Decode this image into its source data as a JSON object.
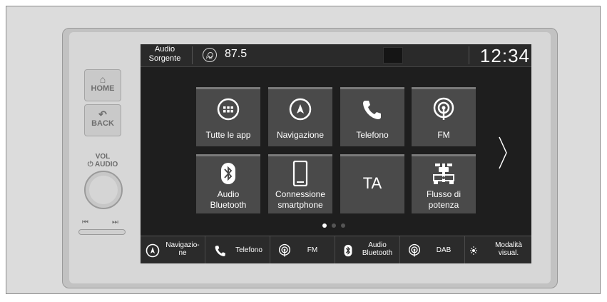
{
  "hard_buttons": {
    "home": "HOME",
    "back": "BACK",
    "vol_line1": "VOL",
    "vol_line2": "⏻ AUDIO",
    "prev_symbol": "⏮",
    "next_symbol": "⏭"
  },
  "status_bar": {
    "source_line1": "Audio",
    "source_line2": "Sorgente",
    "band_badge": "FM",
    "frequency": "87.5",
    "clock": "12:34"
  },
  "apps": [
    {
      "label": "Tutte le app",
      "icon": "grid-icon"
    },
    {
      "label": "Navigazione",
      "icon": "navigation-icon"
    },
    {
      "label": "Telefono",
      "icon": "phone-icon"
    },
    {
      "label": "FM",
      "icon": "radio-icon"
    },
    {
      "label_line1": "Audio",
      "label_line2": "Bluetooth",
      "icon": "bluetooth-icon"
    },
    {
      "label_line1": "Connessione",
      "label_line2": "smartphone",
      "icon": "smartphone-icon"
    },
    {
      "label": "TA",
      "icon": "ta-text"
    },
    {
      "label_line1": "Flusso di",
      "label_line2": "potenza",
      "icon": "power-flow-icon"
    }
  ],
  "pagination": {
    "pages": 3,
    "current": 1
  },
  "bottom_bar": [
    {
      "line1": "Navigazio-",
      "line2": "ne",
      "icon": "navigation-icon"
    },
    {
      "line1": "Telefono",
      "icon": "phone-icon"
    },
    {
      "line1": "FM",
      "icon": "radio-icon"
    },
    {
      "line1": "Audio",
      "line2": "Bluetooth",
      "icon": "bluetooth-icon"
    },
    {
      "line1": "DAB",
      "icon": "radio-icon"
    },
    {
      "line1": "Modalità",
      "line2": "visual.",
      "icon": "day-night-icon"
    }
  ],
  "colors": {
    "screen_bg": "#1e1e1e",
    "tile_bg": "#4a4a4a",
    "text": "#ffffff",
    "bezel": "#c2c2c2"
  }
}
